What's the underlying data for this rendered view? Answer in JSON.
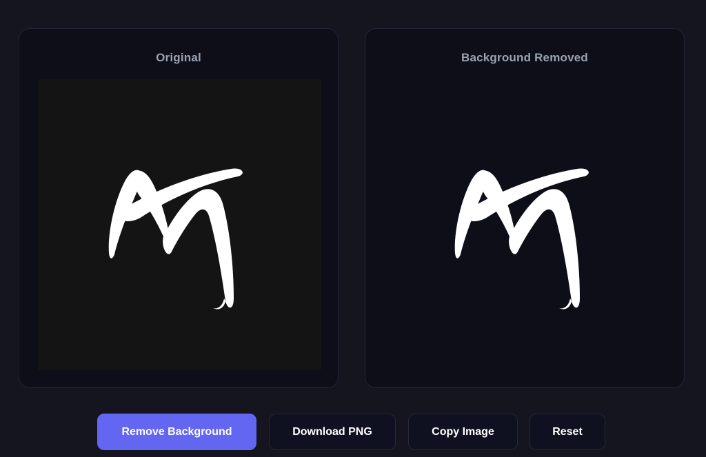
{
  "panels": {
    "original": {
      "title": "Original",
      "background": "#141414"
    },
    "removed": {
      "title": "Background Removed",
      "background": "transparent"
    }
  },
  "logo": {
    "icon": "swoosh-m-logo-icon",
    "color": "#ffffff"
  },
  "toolbar": {
    "remove_label": "Remove Background",
    "download_label": "Download PNG",
    "copy_label": "Copy Image",
    "reset_label": "Reset"
  },
  "colors": {
    "page_background": "#14151f",
    "panel_background": "#0d0e17",
    "accent": "#6366f1",
    "title_text": "#9aa3b3"
  }
}
